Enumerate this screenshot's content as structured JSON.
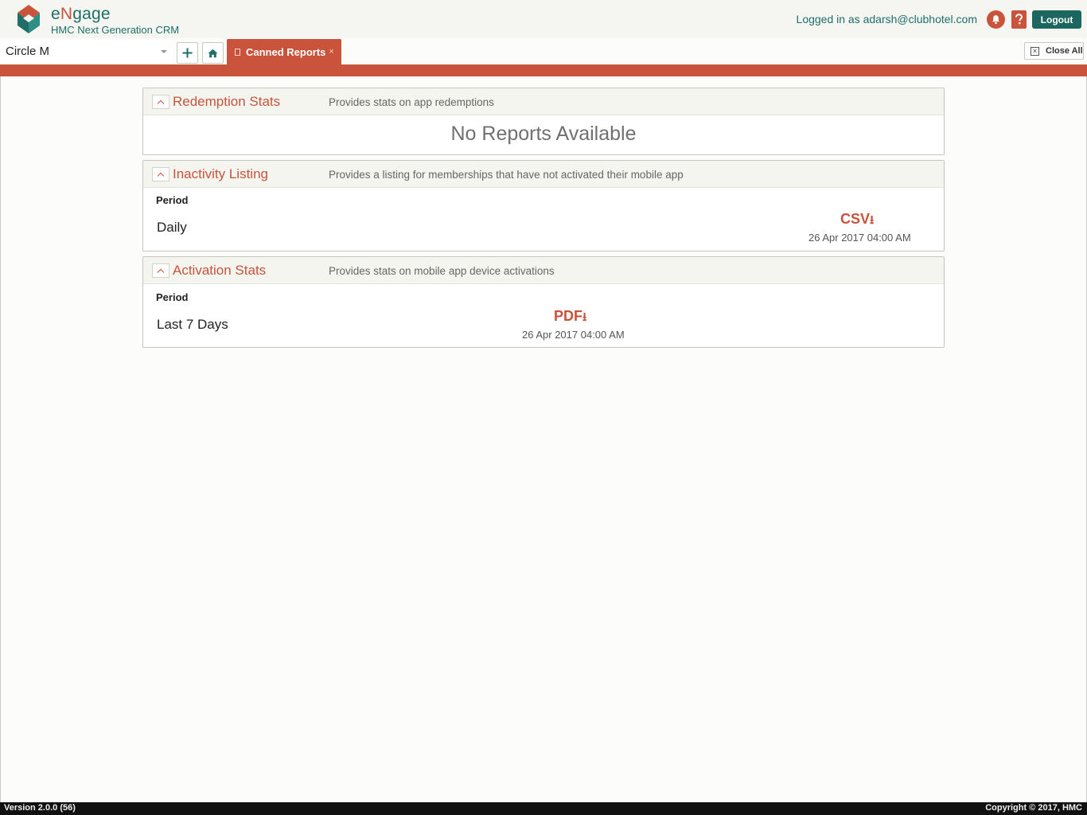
{
  "header": {
    "brand_prefix": "e",
    "brand_n": "N",
    "brand_suffix": "gage",
    "subtitle": "HMC Next Generation CRM",
    "logged_in_text": "Logged in as adarsh@clubhotel.com",
    "logout_label": "Logout",
    "icons": [
      "logo-icon",
      "bell-icon",
      "help-icon"
    ]
  },
  "tabbar": {
    "circle_selected": "Circle M",
    "active_tab": "Canned Reports",
    "active_tab_close": "×",
    "close_all_label": "Close All",
    "icons": [
      "chevron-down-icon",
      "plus-icon",
      "home-icon",
      "document-icon",
      "close-icon"
    ]
  },
  "colors": {
    "accent": "#c9533b",
    "brand_teal": "#1f6e68",
    "footer_bg": "#111111"
  },
  "reports": [
    {
      "title": "Redemption Stats",
      "description": "Provides stats on app redemptions",
      "empty_message": "No Reports Available"
    },
    {
      "title": "Inactivity Listing",
      "description": "Provides a listing for memberships that have not activated their mobile app",
      "period_label": "Period",
      "period_value": "Daily",
      "download_label": "CSV",
      "download_arrow": "⭳",
      "download_date": "26 Apr 2017 04:00 AM"
    },
    {
      "title": "Activation Stats",
      "description": "Provides stats on mobile app device activations",
      "period_label": "Period",
      "period_value": "Last 7 Days",
      "download_label": "PDF",
      "download_arrow": "⭳",
      "download_date": "26 Apr 2017 04:00 AM"
    }
  ],
  "footer": {
    "version": "Version 2.0.0 (56)",
    "copyright": "Copyright © 2017, HMC"
  }
}
